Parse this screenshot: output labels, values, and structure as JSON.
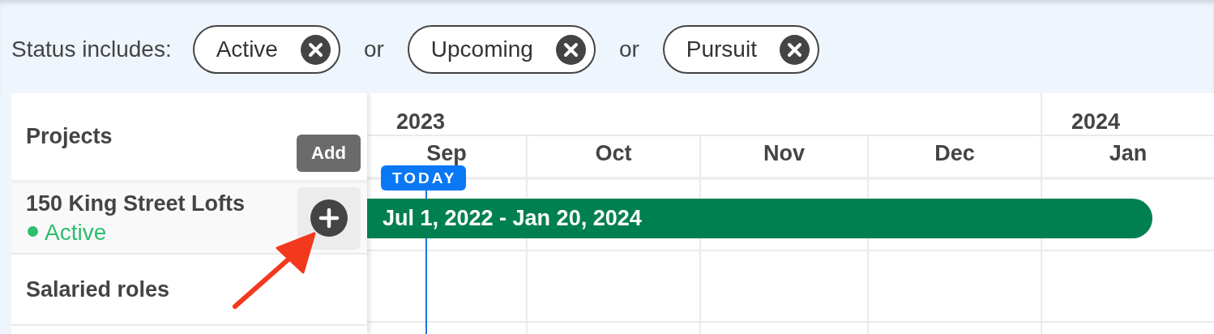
{
  "filter": {
    "label": "Status includes:",
    "chips": [
      {
        "label": "Active"
      },
      {
        "label": "Upcoming"
      },
      {
        "label": "Pursuit"
      }
    ],
    "connectors": [
      "or",
      "or"
    ]
  },
  "sidebar": {
    "title": "Projects",
    "add_button": "Add"
  },
  "timeline": {
    "years": [
      {
        "label": "2023",
        "months": [
          {
            "label": "Sep"
          },
          {
            "label": "Oct"
          },
          {
            "label": "Nov"
          },
          {
            "label": "Dec"
          }
        ]
      },
      {
        "label": "2024",
        "months": [
          {
            "label": "Jan"
          }
        ]
      }
    ],
    "today_label": "TODAY"
  },
  "projects": [
    {
      "name": "150 King Street Lofts",
      "status": "Active",
      "color": "#2dbd6e",
      "bar": {
        "label": "Jul 1, 2022 - Jan 20, 2024"
      }
    }
  ],
  "sections": [
    {
      "label": "Salaried roles"
    }
  ]
}
